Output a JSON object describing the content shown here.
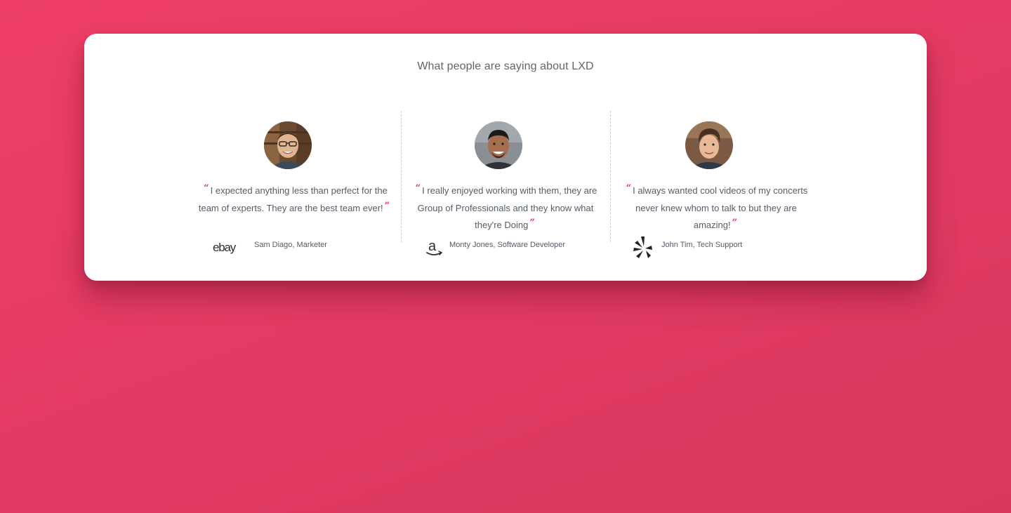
{
  "heading": "What people are saying about LXD",
  "colors": {
    "background": "#e43d64",
    "card": "#ffffff",
    "accent_quote": "#e8384f",
    "text": "#545c66"
  },
  "testimonials": [
    {
      "open_quote": "“",
      "text": "I expected anything less than perfect for the team of experts. They are the best team ever!",
      "close_quote": "”",
      "brand_icon": "ebay-logo",
      "brand_text": "ebay",
      "author": "Sam Diago, Marketer"
    },
    {
      "open_quote": "“",
      "text": "I really enjoyed working with them, they are Group of Professionals and they know what they're Doing",
      "close_quote": "”",
      "brand_icon": "amazon-logo",
      "brand_text": "a",
      "author": "Monty Jones, Software Developer"
    },
    {
      "open_quote": "“",
      "text": "I always wanted cool videos of my concerts never knew whom to talk to but they are amazing!",
      "close_quote": "”",
      "brand_icon": "yelp-logo",
      "author": "John Tim, Tech Support"
    }
  ]
}
